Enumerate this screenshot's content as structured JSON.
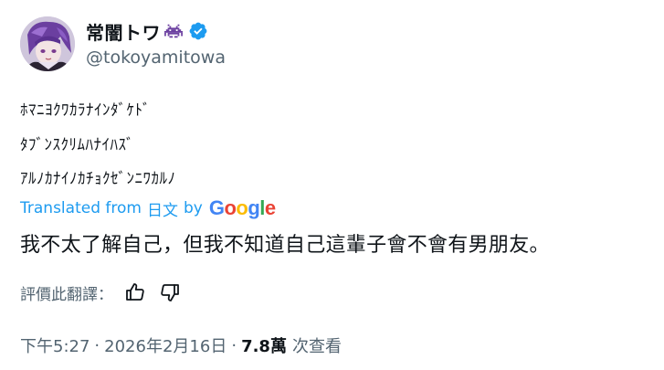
{
  "author": {
    "display_name": "常闇トワ",
    "handle": "@tokoyamitowa"
  },
  "tweet": {
    "original_lines": [
      "ﾎﾏﾆﾖｸﾜｶﾗﾅｲﾝﾀﾞｹﾄﾞ",
      "ﾀﾌﾞﾝｽｸﾘﾑﾊﾅｲﾊｽﾞ",
      "ｱﾙﾉｶﾅｲﾉｶﾁｮｸｾﾞﾝﾆﾜｶﾙﾉ"
    ],
    "translated_prefix": "Translated from",
    "translated_lang": "日文",
    "translated_by": "by",
    "google_letters": [
      "G",
      "o",
      "o",
      "g",
      "l",
      "e"
    ],
    "translated_text": "我不太了解自己，但我不知道自己這輩子會不會有男朋友。",
    "rate_label": "評價此翻譯："
  },
  "meta": {
    "time": "下午5:27",
    "separator": "·",
    "date": "2026年2月16日",
    "views_count": "7.8萬",
    "views_label": "次查看"
  },
  "colors": {
    "link_blue": "#1d9bf0",
    "verified_blue": "#1d9bf0",
    "secondary_text": "#536471",
    "primary_text": "#0f1419",
    "invader_purple": "#6b3fa0"
  },
  "icons": {
    "invader": "space-invader-icon",
    "verified": "verified-badge-icon",
    "thumb_up": "thumbs-up-icon",
    "thumb_down": "thumbs-down-icon"
  }
}
